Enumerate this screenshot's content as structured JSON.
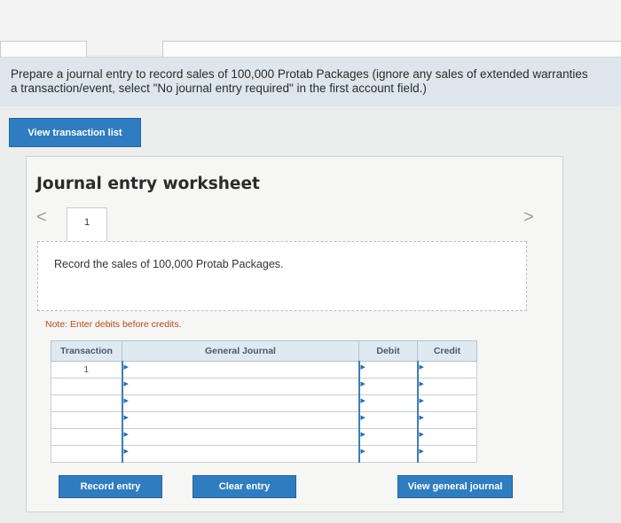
{
  "instructions": {
    "line1": "Prepare a journal entry to record sales of 100,000 Protab Packages (ignore any sales of extended warranties",
    "line2": "a transaction/event, select \"No journal entry required\" in the first account field.)"
  },
  "buttons": {
    "view_transaction_list": "View transaction list",
    "record_entry": "Record entry",
    "clear_entry": "Clear entry",
    "view_general_journal": "View general journal"
  },
  "worksheet": {
    "title": "Journal entry worksheet",
    "current_tab": "1",
    "prev_glyph": "<",
    "next_glyph": ">",
    "description": "Record the sales of 100,000 Protab Packages.",
    "note": "Note: Enter debits before credits."
  },
  "journal": {
    "headers": [
      "Transaction",
      "General Journal",
      "Debit",
      "Credit"
    ],
    "rows": [
      {
        "transaction": "1",
        "account": "",
        "debit": "",
        "credit": ""
      },
      {
        "transaction": "",
        "account": "",
        "debit": "",
        "credit": ""
      },
      {
        "transaction": "",
        "account": "",
        "debit": "",
        "credit": ""
      },
      {
        "transaction": "",
        "account": "",
        "debit": "",
        "credit": ""
      },
      {
        "transaction": "",
        "account": "",
        "debit": "",
        "credit": ""
      },
      {
        "transaction": "",
        "account": "",
        "debit": "",
        "credit": ""
      }
    ]
  },
  "colors": {
    "button": "#2f7dc0",
    "instructions_bg": "#dde6ec",
    "header_bg": "#dfe9f1",
    "note": "#b24a1c"
  }
}
